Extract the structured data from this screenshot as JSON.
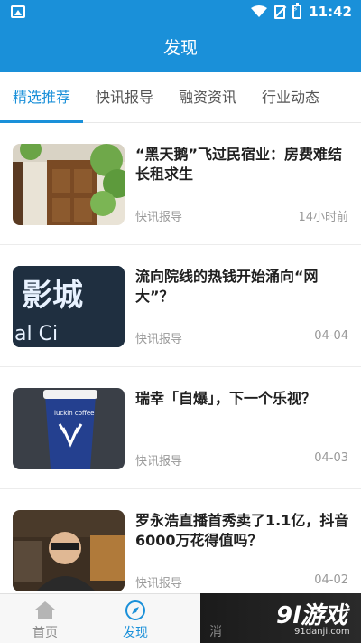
{
  "status_bar": {
    "time": "11:42"
  },
  "header": {
    "title": "发现"
  },
  "tabs": [
    {
      "label": "精选推荐",
      "active": true
    },
    {
      "label": "快讯报导",
      "active": false
    },
    {
      "label": "融资资讯",
      "active": false
    },
    {
      "label": "行业动态",
      "active": false
    }
  ],
  "news": [
    {
      "title": "“黑天鹅”飞过民宿业：房费难结 长租求生",
      "source": "快讯报导",
      "time": "14小时前",
      "thumb": "door-photo"
    },
    {
      "title": "流向院线的热钱开始涌向“网大”？",
      "source": "快讯报导",
      "time": "04-04",
      "thumb": "cinema-sign-photo"
    },
    {
      "title": "瑞幸「自爆」，下一个乐视？",
      "source": "快讯报导",
      "time": "04-03",
      "thumb": "coffee-cup-photo"
    },
    {
      "title": "罗永浩直播首秀卖了1.1亿，抖音6000万花得值吗？",
      "source": "快讯报导",
      "time": "04-02",
      "thumb": "livestream-photo"
    }
  ],
  "thumb_texts": {
    "cinema_sign": "影城",
    "cinema_sub": "al Ci",
    "cup_brand": "luckin coffee"
  },
  "bottom_nav": [
    {
      "label": "首页",
      "icon": "home-icon",
      "active": false
    },
    {
      "label": "发现",
      "icon": "compass-icon",
      "active": true
    },
    {
      "label": "消",
      "icon": "message-icon",
      "active": false
    }
  ],
  "watermark": {
    "logo": "9l游戏",
    "url": "91danji.com"
  },
  "colors": {
    "brand": "#1a90d9",
    "muted": "#999999"
  }
}
